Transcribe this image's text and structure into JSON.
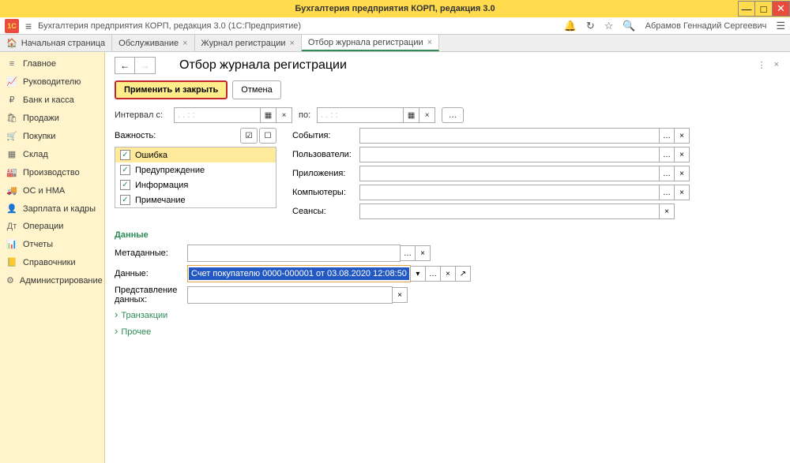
{
  "window": {
    "title": "Бухгалтерия предприятия КОРП, редакция 3.0",
    "subtitle": "Бухгалтерия предприятия КОРП, редакция 3.0  (1С:Предприятие)",
    "user": "Абрамов Геннадий Сергеевич"
  },
  "tabs": [
    {
      "label": "Начальная страница",
      "closable": false
    },
    {
      "label": "Обслуживание",
      "closable": true
    },
    {
      "label": "Журнал регистрации",
      "closable": true
    },
    {
      "label": "Отбор журнала регистрации",
      "closable": true,
      "active": true
    }
  ],
  "sidebar": [
    {
      "icon": "≡",
      "label": "Главное"
    },
    {
      "icon": "📈",
      "label": "Руководителю"
    },
    {
      "icon": "₽",
      "label": "Банк и касса"
    },
    {
      "icon": "🛍",
      "label": "Продажи"
    },
    {
      "icon": "🛒",
      "label": "Покупки"
    },
    {
      "icon": "▦",
      "label": "Склад"
    },
    {
      "icon": "🏭",
      "label": "Производство"
    },
    {
      "icon": "🚚",
      "label": "ОС и НМА"
    },
    {
      "icon": "👤",
      "label": "Зарплата и кадры"
    },
    {
      "icon": "Дт",
      "label": "Операции"
    },
    {
      "icon": "📊",
      "label": "Отчеты"
    },
    {
      "icon": "📒",
      "label": "Справочники"
    },
    {
      "icon": "⚙",
      "label": "Администрирование"
    }
  ],
  "page": {
    "title": "Отбор журнала регистрации",
    "apply": "Применить и закрыть",
    "cancel": "Отмена"
  },
  "interval": {
    "label": "Интервал с:",
    "to": "по:",
    "placeholder": " .  .      :  :"
  },
  "severity": {
    "label": "Важность:",
    "items": [
      "Ошибка",
      "Предупреждение",
      "Информация",
      "Примечание"
    ]
  },
  "filters": {
    "events": "События:",
    "users": "Пользователи:",
    "apps": "Приложения:",
    "computers": "Компьютеры:",
    "sessions": "Сеансы:"
  },
  "data_section": {
    "title": "Данные",
    "metadata": "Метаданные:",
    "data": "Данные:",
    "data_value": "Счет покупателю 0000-000001 от 03.08.2020 12:08:50",
    "repr": "Представление данных:"
  },
  "expands": [
    "Транзакции",
    "Прочее"
  ]
}
